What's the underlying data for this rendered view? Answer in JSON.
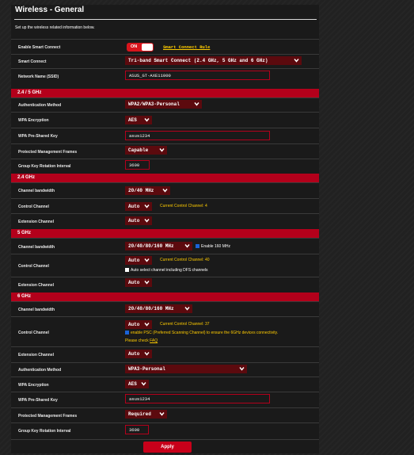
{
  "page": {
    "title": "Wireless - General",
    "description": "Set up the wireless related information below."
  },
  "general": {
    "smart_connect_label": "Enable Smart Connect",
    "smart_connect_toggle": "ON",
    "smart_connect_rule": "Smart Connect Rule",
    "smart_connect_mode_label": "Smart Connect",
    "smart_connect_mode": "Tri-band Smart Connect (2.4 GHz, 5 GHz and 6 GHz)",
    "ssid_label": "Network Name (SSID)",
    "ssid": "ASUS_GT-AXE11000"
  },
  "band_24_5": {
    "header": "2.4 / 5 GHz",
    "auth_label": "Authentication Method",
    "auth": "WPA2/WPA3-Personal",
    "enc_label": "WPA Encryption",
    "enc": "AES",
    "psk_label": "WPA Pre-Shared Key",
    "psk": "asus1234",
    "pmf_label": "Protected Management Frames",
    "pmf": "Capable",
    "gkri_label": "Group Key Rotation Interval",
    "gkri": "3600"
  },
  "band_24": {
    "header": "2.4 GHz",
    "bw_label": "Channel bandwidth",
    "bw": "20/40 MHz",
    "cc_label": "Control Channel",
    "cc": "Auto",
    "cc_note": "Current Control Channel: 4",
    "ext_label": "Extension Channel",
    "ext": "Auto"
  },
  "band_5": {
    "header": "5 GHz",
    "bw_label": "Channel bandwidth",
    "bw": "20/40/80/160 MHz",
    "bw_160": "Enable 160 MHz",
    "cc_label": "Control Channel",
    "cc": "Auto",
    "cc_note": "Current Control Channel: 40",
    "dfs": "Auto select channel including DFS channels",
    "ext_label": "Extension Channel",
    "ext": "Auto"
  },
  "band_6": {
    "header": "6 GHz",
    "bw_label": "Channel bandwidth",
    "bw": "20/40/80/160 MHz",
    "cc_label": "Control Channel",
    "cc": "Auto",
    "cc_note": "Current Control Channel: 37",
    "psc": "enable PSC (Preferred Scanning Channel) to ensure the 6GHz devices connectivity.",
    "psc_check": "Please check",
    "faq": "FAQ",
    "ext_label": "Extension Channel",
    "ext": "Auto",
    "auth_label": "Authentication Method",
    "auth": "WPA3-Personal",
    "enc_label": "WPA Encryption",
    "enc": "AES",
    "psk_label": "WPA Pre-Shared Key",
    "psk": "asus1234",
    "pmf_label": "Protected Management Frames",
    "pmf": "Required",
    "gkri_label": "Group Key Rotation Interval",
    "gkri": "3600"
  },
  "apply_label": "Apply",
  "icons": {
    "dropdown": "chevron-down-icon",
    "checkbox": "checkbox-icon"
  },
  "colors": {
    "accent": "#b3001b",
    "select_bg": "#5c0a0e",
    "note": "#ffcc00",
    "toggle": "#d8141c"
  }
}
